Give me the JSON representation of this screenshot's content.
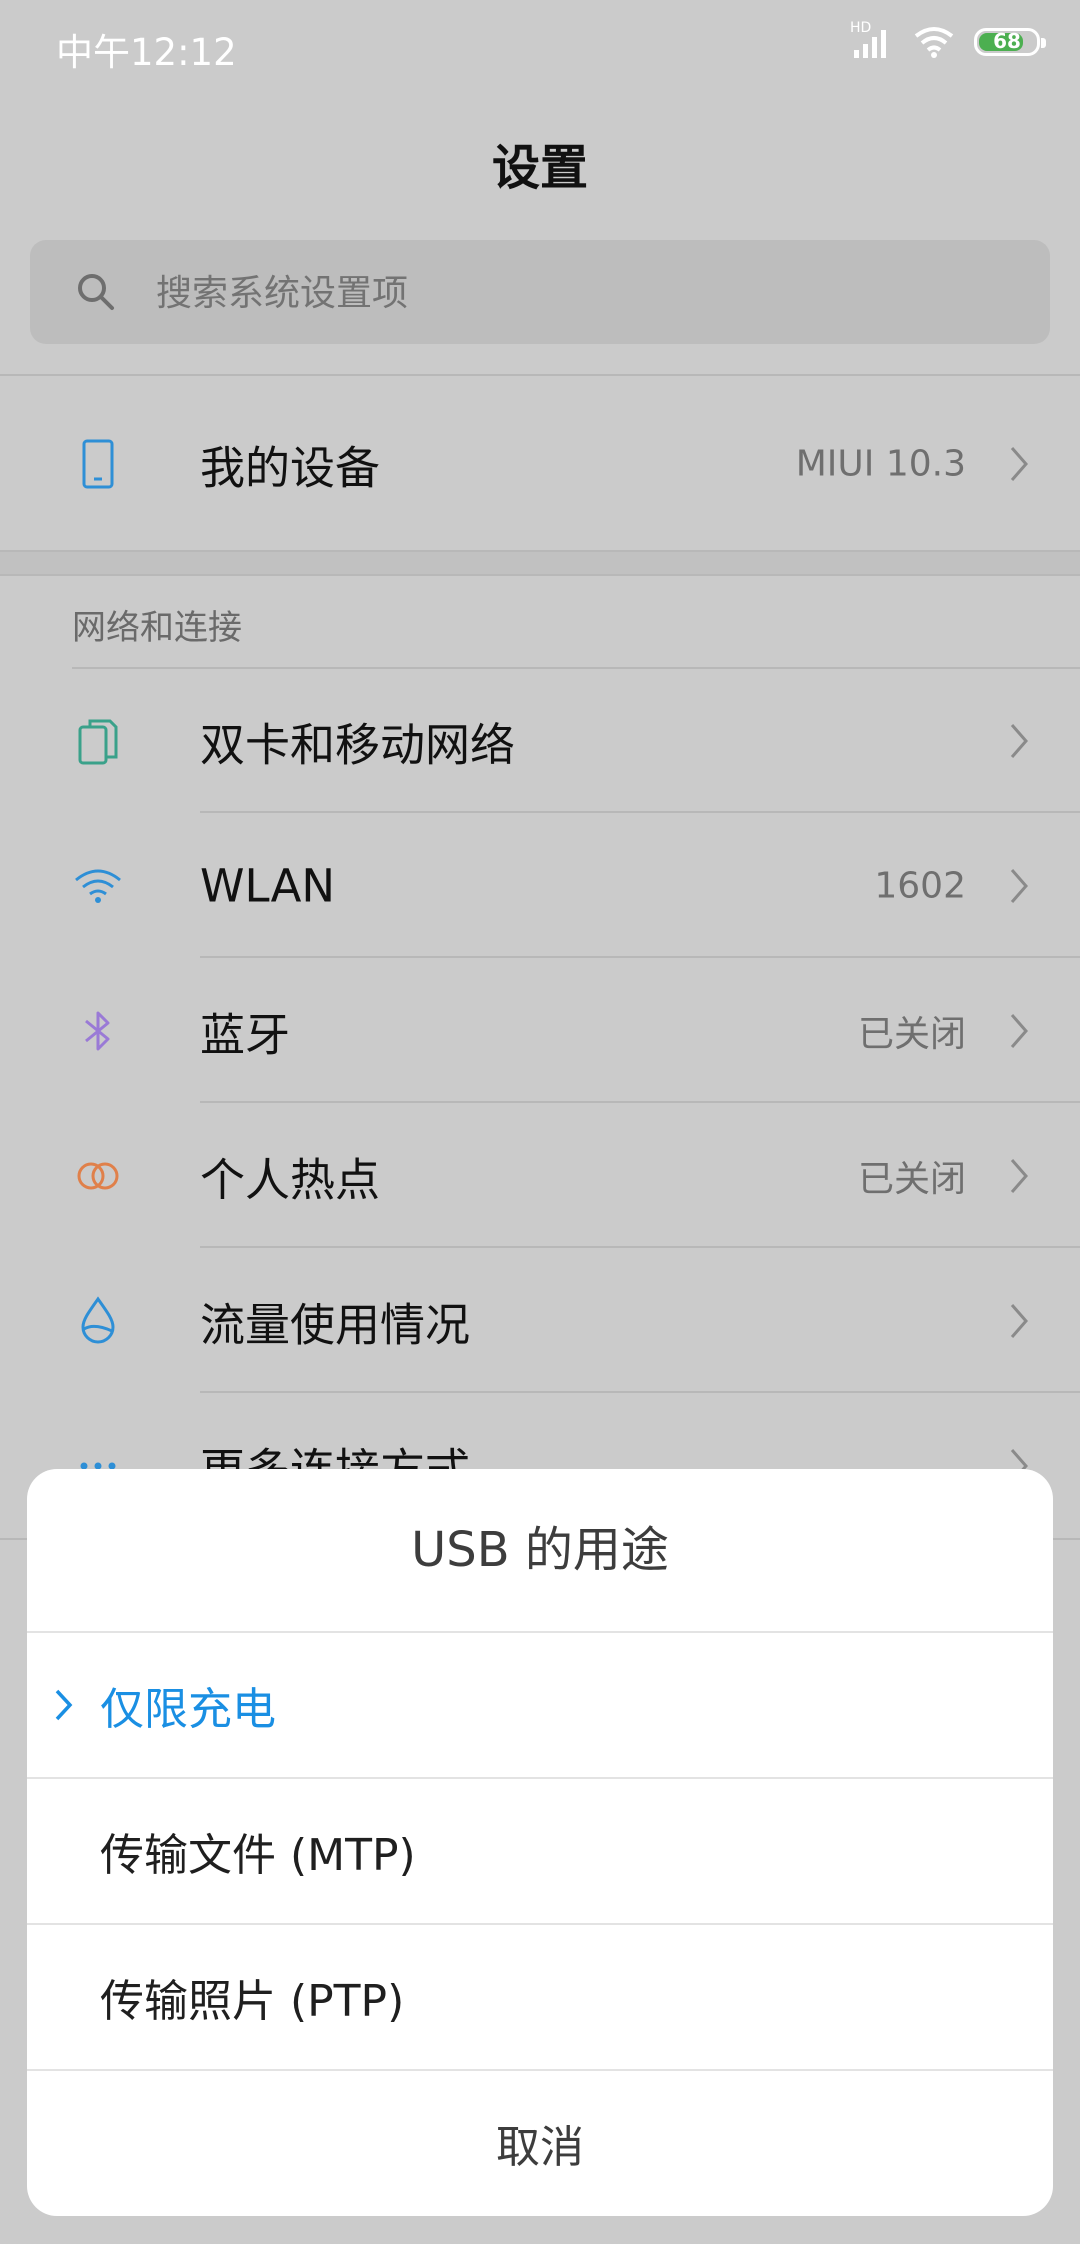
{
  "status_bar": {
    "time": "中午12:12",
    "network_label": "HD",
    "battery": "68",
    "icons": [
      "signal-icon",
      "wifi-icon",
      "battery-icon"
    ]
  },
  "header": {
    "title": "设置"
  },
  "search": {
    "placeholder": "搜索系统设置项"
  },
  "my_device": {
    "label": "我的设备",
    "value": "MIUI 10.3"
  },
  "section": {
    "title": "网络和连接"
  },
  "network_items": [
    {
      "label": "双卡和移动网络",
      "value": "",
      "icon": "sim-cards-icon",
      "color": "#3aa18a"
    },
    {
      "label": "WLAN",
      "value": "1602",
      "icon": "wifi-icon",
      "color": "#2e8fd6"
    },
    {
      "label": "蓝牙",
      "value": "已关闭",
      "icon": "bluetooth-icon",
      "color": "#9a7ad6"
    },
    {
      "label": "个人热点",
      "value": "已关闭",
      "icon": "hotspot-icon",
      "color": "#e0804a"
    },
    {
      "label": "流量使用情况",
      "value": "",
      "icon": "data-usage-icon",
      "color": "#2e8fd6"
    },
    {
      "label": "更多连接方式",
      "value": "",
      "icon": "more-icon",
      "color": "#2e8fd6"
    }
  ],
  "dialog": {
    "title": "USB 的用途",
    "options": [
      {
        "label": "仅限充电",
        "selected": true
      },
      {
        "label": "传输文件 (MTP)",
        "selected": false
      },
      {
        "label": "传输照片 (PTP)",
        "selected": false
      }
    ],
    "cancel": "取消",
    "accent_color": "#1a8fe3"
  }
}
